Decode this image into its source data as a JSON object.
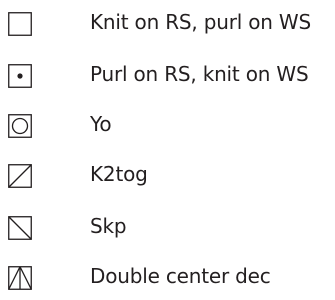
{
  "legend": {
    "items": [
      {
        "symbol": "empty-square-icon",
        "label": "Knit on RS, purl on WS"
      },
      {
        "symbol": "dot-square-icon",
        "label": "Purl on RS, knit on WS"
      },
      {
        "symbol": "circle-square-icon",
        "label": "Yo"
      },
      {
        "symbol": "right-slant-square-icon",
        "label": "K2tog"
      },
      {
        "symbol": "left-slant-square-icon",
        "label": "Skp"
      },
      {
        "symbol": "center-point-square-icon",
        "label": "Double center dec"
      }
    ]
  }
}
